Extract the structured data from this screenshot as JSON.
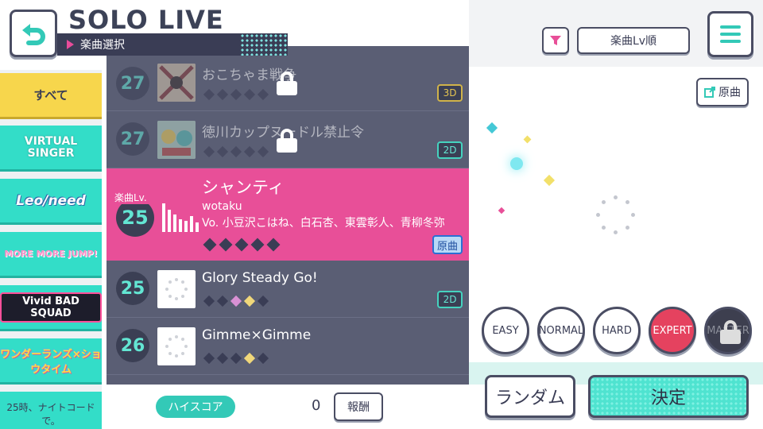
{
  "header": {
    "title": "SOLO LIVE",
    "subtitle": "楽曲選択"
  },
  "sidebar": {
    "items": [
      {
        "label": "すべて"
      },
      {
        "label": "VIRTUAL\nSINGER"
      },
      {
        "label": "Leo/need"
      },
      {
        "label": "MORE MORE JUMP!"
      },
      {
        "label": "Vivid BAD SQUAD"
      },
      {
        "label": "ワンダーランズ×ショウタイム"
      },
      {
        "label": "25時、ナイトコードで。"
      }
    ]
  },
  "songs": [
    {
      "level": "27",
      "name": "おこちゃま戦争",
      "tag": "3D",
      "locked": true
    },
    {
      "level": "27",
      "name": "徳川カップヌードル禁止令",
      "tag": "2D",
      "locked": true
    },
    {
      "level": "25",
      "name": "シャンティ",
      "level_label": "楽曲Lv.",
      "artist": "wotaku",
      "vocals": "Vo. 小豆沢こはね、白石杏、東雲彰人、青柳冬弥",
      "tag": "原曲",
      "selected": true
    },
    {
      "level": "25",
      "name": "Glory Steady Go!",
      "tag": "2D"
    },
    {
      "level": "26",
      "name": "Gimme×Gimme",
      "tag": ""
    }
  ],
  "bottom": {
    "hiscore_label": "ハイスコア",
    "score": "0",
    "reward_label": "報酬"
  },
  "right": {
    "sort_label": "楽曲Lv順",
    "original_label": "原曲",
    "difficulties": [
      "EASY",
      "NORMAL",
      "HARD",
      "EXPERT",
      "MASTER"
    ],
    "random_label": "ランダム",
    "confirm_label": "決定"
  },
  "colors": {
    "accent_pink": "#e84f98",
    "accent_teal": "#33ddc8",
    "dark": "#3a3d55",
    "expert": "#e5425f"
  }
}
